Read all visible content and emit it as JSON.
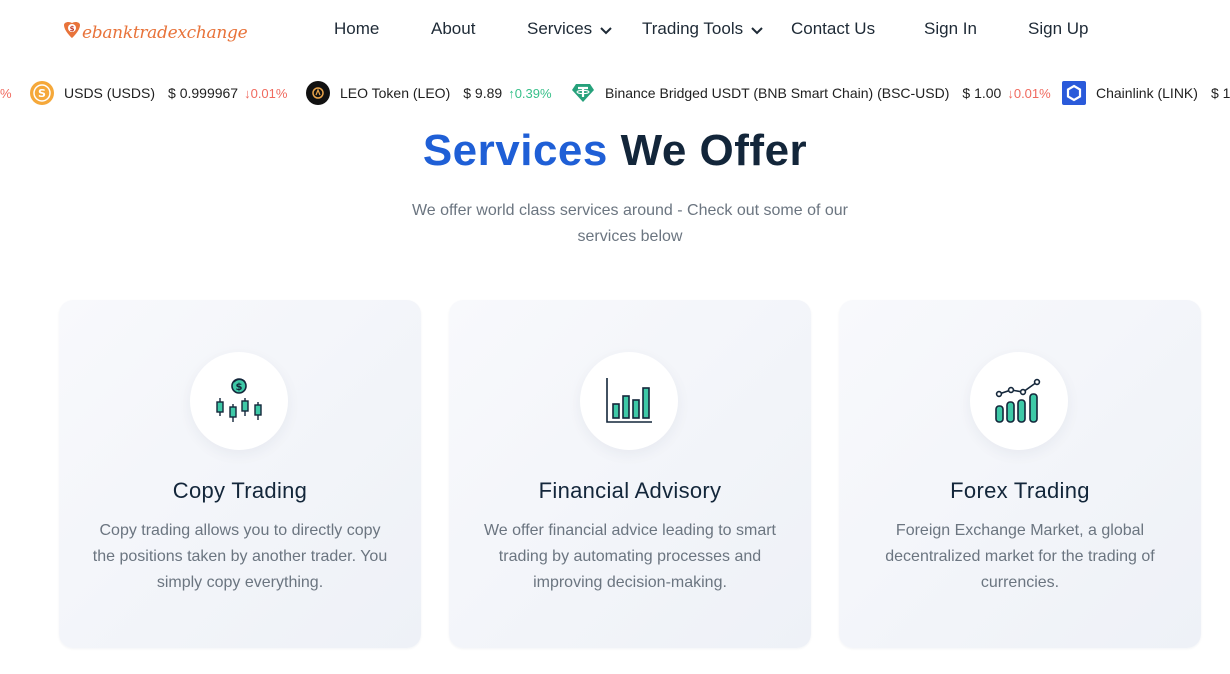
{
  "brand": {
    "name": "ebanktradexchange"
  },
  "nav": {
    "items": [
      {
        "label": "Home"
      },
      {
        "label": "About"
      },
      {
        "label": "Services"
      },
      {
        "label": "Trading Tools"
      },
      {
        "label": "Contact Us"
      },
      {
        "label": "Sign In"
      },
      {
        "label": "Sign Up"
      }
    ]
  },
  "ticker": {
    "lead_fragment": "%",
    "items": [
      {
        "name": "USDS (USDS)",
        "price": "$ 0.999967",
        "change": "0.01%",
        "direction": "down"
      },
      {
        "name": "LEO Token (LEO)",
        "price": "$ 9.89",
        "change": "0.39%",
        "direction": "up"
      },
      {
        "name": "Binance Bridged USDT (BNB Smart Chain) (BSC-USD)",
        "price": "$ 1.00",
        "change": "0.01%",
        "direction": "down"
      },
      {
        "name": "Chainlink (LINK)",
        "price": "$ 1:",
        "change": "",
        "direction": ""
      }
    ]
  },
  "section": {
    "title_highlight": "Services",
    "title_rest": "We Offer",
    "subtitle": "We offer world class services around - Check out some of our services below"
  },
  "cards": [
    {
      "title": "Copy Trading",
      "text": "Copy trading allows you to directly copy the positions taken by another trader. You simply copy everything.",
      "icon": "candlestick-dollar-icon"
    },
    {
      "title": "Financial Advisory",
      "text": "We offer financial advice leading to smart trading by automating processes and improving decision-making.",
      "icon": "bar-chart-icon"
    },
    {
      "title": "Forex Trading",
      "text": "Foreign Exchange Market, a global decentralized market for the trading of currencies.",
      "icon": "growth-chart-icon"
    }
  ],
  "colors": {
    "accent_blue": "#1f5fd6",
    "heading_dark": "#13263a",
    "brand_orange": "#e8733a",
    "icon_teal": "#3ec9a7",
    "down_red": "#f06a5f",
    "up_green": "#38c08a"
  }
}
